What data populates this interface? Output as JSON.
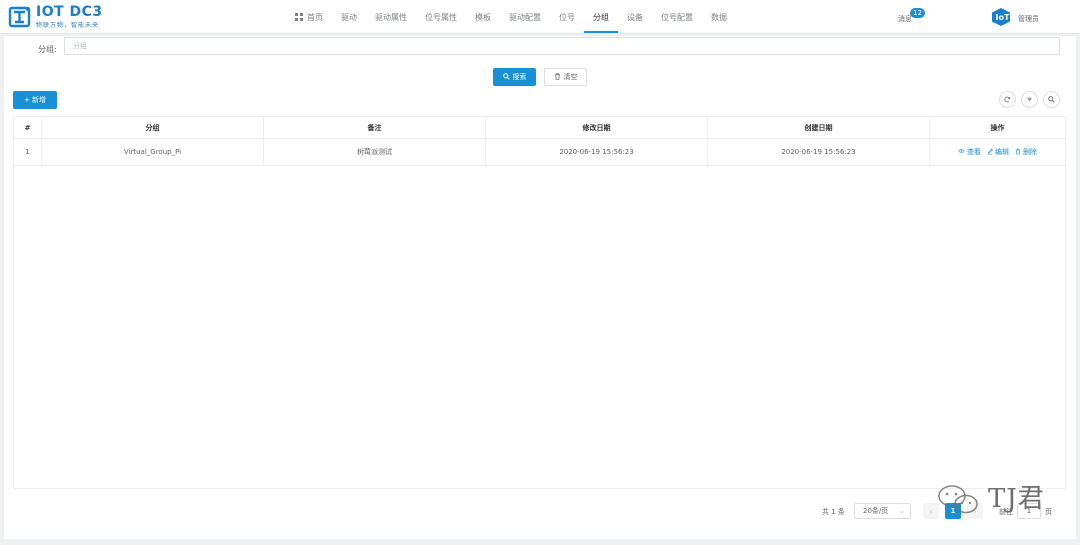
{
  "header": {
    "logo_title": "IOT DC3",
    "logo_slogan": "物联万物，智能未来",
    "nav": [
      "首页",
      "驱动",
      "驱动属性",
      "位号属性",
      "模板",
      "驱动配置",
      "位号",
      "分组",
      "设备",
      "位号配置",
      "数据"
    ],
    "active_nav": "分组",
    "message_label": "消息",
    "message_count": "12",
    "user_name": "管理员"
  },
  "search": {
    "label": "分组:",
    "placeholder": "分组",
    "search_button": "搜索",
    "clear_button": "清空"
  },
  "toolbar": {
    "add_button": "+ 新增"
  },
  "table": {
    "columns": [
      "#",
      "分组",
      "备注",
      "修改日期",
      "创建日期",
      "操作"
    ],
    "rows": [
      {
        "index": "1",
        "group": "Virtual_Group_Pi",
        "remark": "树莓派测试",
        "modified": "2020-06-19 15:56:23",
        "created": "2020-06-19 15:56:23"
      }
    ],
    "actions": {
      "view": "查看",
      "edit": "编辑",
      "delete": "删除"
    }
  },
  "pagination": {
    "total": "共 1 条",
    "page_size": "20条/页",
    "current_page": "1",
    "goto_label": "前往",
    "goto_value": "1",
    "page_suffix": "页"
  },
  "watermark_text": "TJ君",
  "colors": {
    "primary": "#1890d8",
    "logo": "#1a7fd1"
  }
}
